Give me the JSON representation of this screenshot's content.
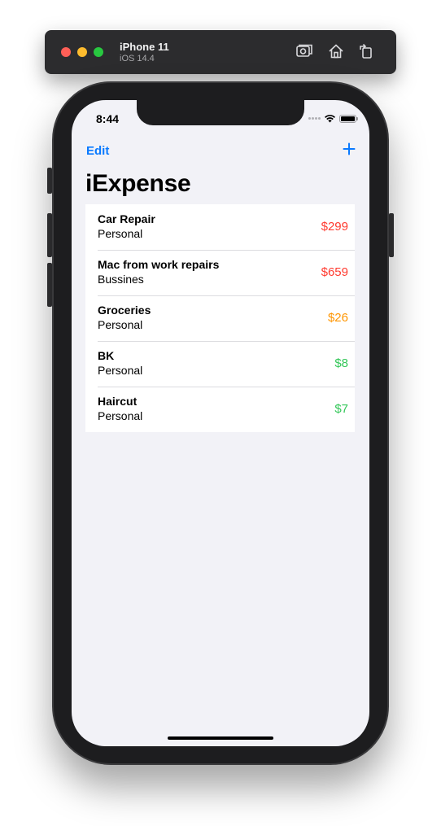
{
  "simulator": {
    "device_name": "iPhone 11",
    "os_version": "iOS 14.4",
    "tools": [
      "screenshot-icon",
      "home-icon",
      "rotate-icon"
    ]
  },
  "status_bar": {
    "time": "8:44"
  },
  "nav": {
    "edit_label": "Edit",
    "add_icon": "plus-icon"
  },
  "title": "iExpense",
  "expenses": [
    {
      "name": "Car Repair",
      "type": "Personal",
      "amount": "$299",
      "color": "#ff3b30"
    },
    {
      "name": "Mac from work repairs",
      "type": "Bussines",
      "amount": "$659",
      "color": "#ff3b30"
    },
    {
      "name": "Groceries",
      "type": "Personal",
      "amount": "$26",
      "color": "#ff9500"
    },
    {
      "name": "BK",
      "type": "Personal",
      "amount": "$8",
      "color": "#34c759"
    },
    {
      "name": "Haircut",
      "type": "Personal",
      "amount": "$7",
      "color": "#34c759"
    }
  ],
  "colors": {
    "accent": "#0a7aff",
    "background": "#f2f2f7"
  }
}
